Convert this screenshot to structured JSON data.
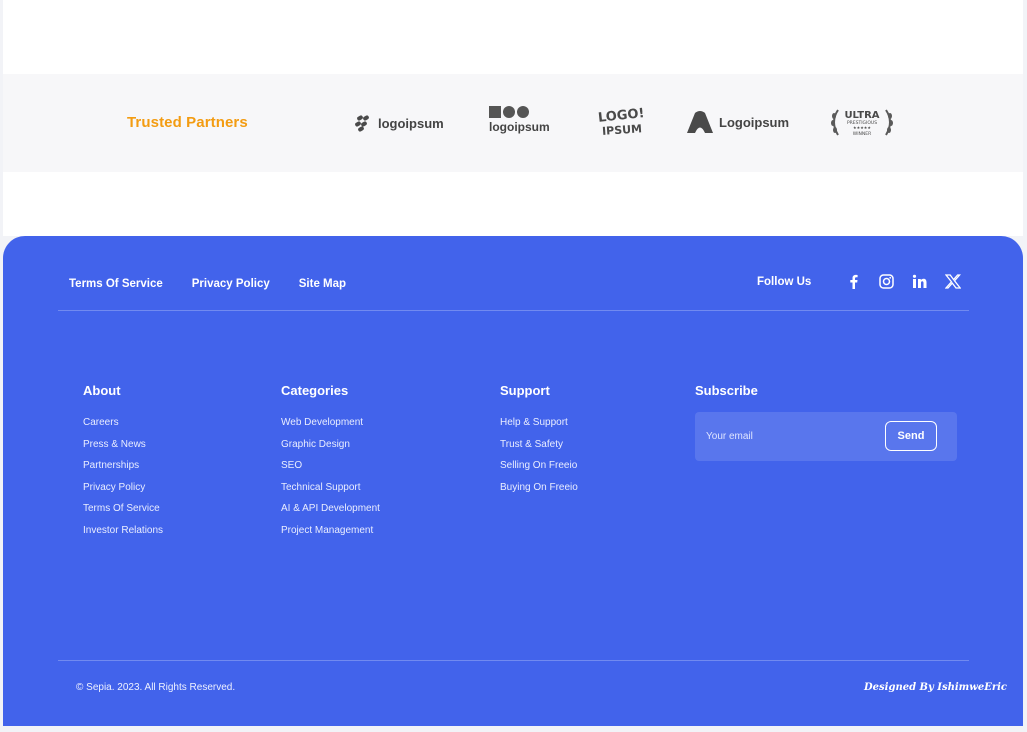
{
  "partners": {
    "title": "Trusted Partners",
    "logos": [
      {
        "name": "logoipsum-1",
        "text": "logoipsum"
      },
      {
        "name": "logoipsum-2",
        "text": "logoipsum"
      },
      {
        "name": "logoipsum-3",
        "text": "LOGO! IPSUM"
      },
      {
        "name": "logoipsum-4",
        "text": "Logoipsum"
      },
      {
        "name": "ultra-badge",
        "text": "ULTRA PRESTIGIOUS WINNER"
      }
    ]
  },
  "footer": {
    "links": [
      "Terms Of Service",
      "Privacy Policy",
      "Site Map"
    ],
    "follow_label": "Follow Us",
    "social_icons": [
      "facebook-icon",
      "instagram-icon",
      "linkedin-icon",
      "x-icon"
    ],
    "about": {
      "title": "About",
      "items": [
        "Careers",
        "Press & News",
        "Partnerships",
        "Privacy Policy",
        "Terms Of Service",
        "Investor Relations"
      ]
    },
    "categories": {
      "title": "Categories",
      "items": [
        "Web Development",
        "Graphic Design",
        "SEO",
        "Technical Support",
        "AI & API Development",
        "Project Management"
      ]
    },
    "support": {
      "title": "Support",
      "items": [
        "Help & Support",
        "Trust & Safety",
        "Selling On Freeio",
        "Buying On Freeio"
      ]
    },
    "subscribe": {
      "title": "Subscribe",
      "placeholder": "Your email",
      "button": "Send"
    },
    "copyright": "© Sepia. 2023. All Rights Reserved.",
    "designed_by": "Designed By IshimweEric"
  },
  "colors": {
    "accent": "#4263eb",
    "partners_title": "#f39c12"
  }
}
